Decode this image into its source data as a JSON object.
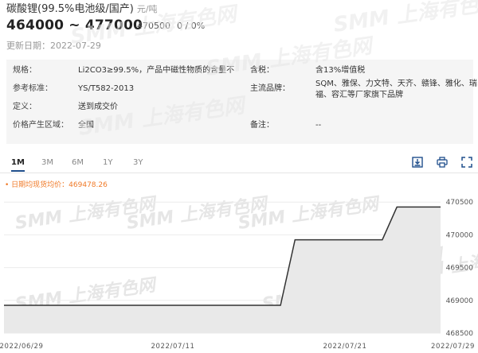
{
  "header": {
    "title": "碳酸锂(99.5%电池级/国产)",
    "unit": "元/吨",
    "price_range": "464000 ~ 477000",
    "average": "470500",
    "change": "0 / 0%",
    "updated": "更新日期：2022-07-29"
  },
  "watermark": "SMM 上海有色网",
  "specs": {
    "left": [
      {
        "label": "规格：",
        "value": "Li2CO3≥99.5%，产品中磁性物质的含量不..."
      },
      {
        "label": "参考标准：",
        "value": "YS/T582-2013"
      },
      {
        "label": "定义：",
        "value": "送到成交价"
      },
      {
        "label": "价格产生区域：",
        "value": "全国"
      }
    ],
    "right": [
      {
        "label": "含税：",
        "value": "含13%增值税"
      },
      {
        "label": "主流品牌：",
        "value_line1": "SQM、雅保、力文特、天齐、赣锋、雅化、瑞",
        "value_line2": "福、容汇等厂家旗下品牌"
      },
      {
        "label": "备注：",
        "value": "--"
      }
    ]
  },
  "tabs": [
    "1M",
    "3M",
    "6M",
    "1Y",
    "3Y"
  ],
  "active_tab": "1M",
  "toolbar": {
    "icons": [
      "download-icon",
      "print-icon",
      "fullscreen-icon"
    ]
  },
  "legend": "日期均现货均价：469478.26",
  "colors": {
    "accent": "#1f4e8c",
    "legend": "#f07a28",
    "line": "#333333",
    "area": "#e9e9e9"
  },
  "chart_data": {
    "type": "area",
    "title": "",
    "xlabel": "",
    "ylabel": "",
    "x": [
      "2022-06-29",
      "2022-07-01",
      "2022-07-04",
      "2022-07-06",
      "2022-07-08",
      "2022-07-11",
      "2022-07-13",
      "2022-07-15",
      "2022-07-18",
      "2022-07-19",
      "2022-07-20",
      "2022-07-21",
      "2022-07-22",
      "2022-07-25",
      "2022-07-26",
      "2022-07-27",
      "2022-07-28",
      "2022-07-29"
    ],
    "series": [
      {
        "name": "",
        "values": [
          468925,
          468925,
          468925,
          468925,
          468925,
          468925,
          468925,
          468925,
          468925,
          469925,
          469925,
          469925,
          469925,
          469925,
          470425,
          470425,
          470425,
          470425
        ]
      }
    ],
    "ylim": [
      468500,
      470600
    ],
    "yticks": [
      468500,
      469000,
      469500,
      470000,
      470500
    ],
    "xticks": [
      "2022/06/29",
      "2022/07/11",
      "2022/07/21",
      "2022/07/29"
    ],
    "grid": true,
    "legend_position": "top-left"
  }
}
